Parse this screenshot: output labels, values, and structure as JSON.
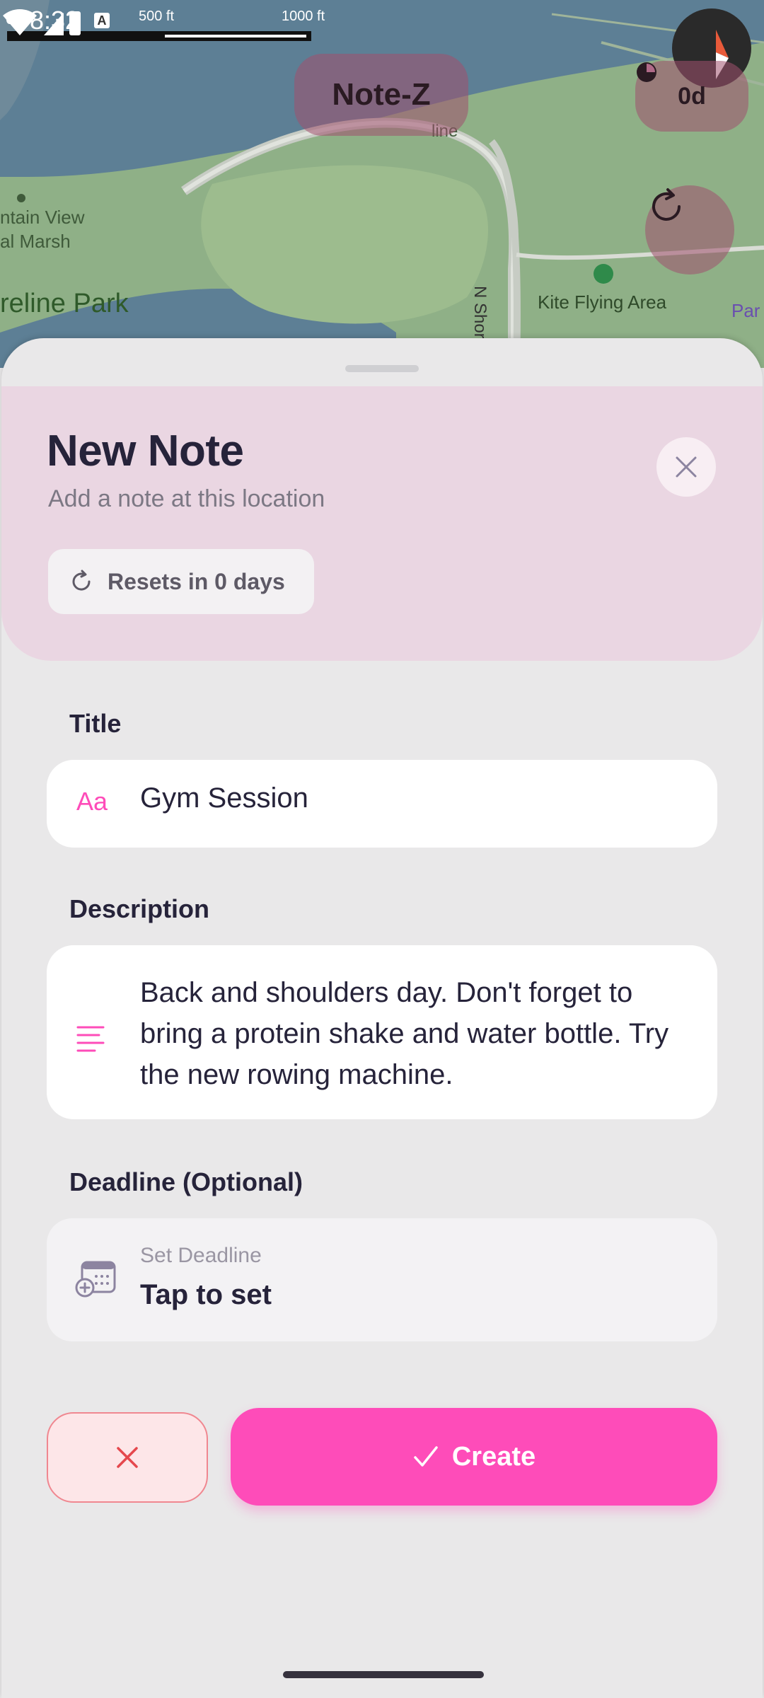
{
  "status_bar": {
    "time": "8:32",
    "left_digit": "0",
    "a_badge": "A"
  },
  "map": {
    "scale_labels": [
      "500 ft",
      "1000 ft"
    ],
    "labels": {
      "line_partial": "line",
      "mountain_view": "ntain View",
      "marsh": "al Marsh",
      "park": "reline Park",
      "road": "N Shore",
      "kite": "Kite Flying Area",
      "par": "Par"
    },
    "app_title": "Note-Z",
    "days_counter": "0d"
  },
  "sheet": {
    "title": "New Note",
    "subtitle": "Add a note at this location",
    "reset_chip": "Resets in 0 days",
    "title_label": "Title",
    "title_icon_text": "Aa",
    "title_value": "Gym Session",
    "description_label": "Description",
    "description_value": "Back and shoulders day. Don't forget to bring a protein shake and water bottle. Try the new rowing machine.",
    "deadline_label": "Deadline (Optional)",
    "deadline_small": "Set Deadline",
    "deadline_action": "Tap to set",
    "create_label": "Create"
  },
  "colors": {
    "accent": "#fe4cb9",
    "header_bg": "#ead6e2",
    "cancel_border": "#f08790"
  }
}
